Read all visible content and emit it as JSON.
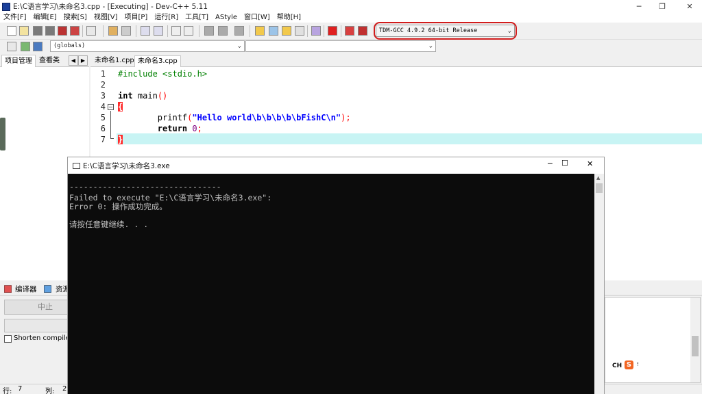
{
  "window": {
    "title": "E:\\C语言学习\\未命名3.cpp - [Executing] - Dev-C++ 5.11",
    "minimize": "─",
    "maximize": "❐",
    "close": "✕"
  },
  "menu": [
    "文件[F]",
    "编辑[E]",
    "搜索[S]",
    "视图[V]",
    "项目[P]",
    "运行[R]",
    "工具[T]",
    "AStyle",
    "窗口[W]",
    "帮助[H]"
  ],
  "toolbar": {
    "compiler": "TDM-GCC 4.9.2 64-bit Release",
    "compiler_highlight_color": "#d21c1c"
  },
  "toolbar2": {
    "scope": "(globals)",
    "member": ""
  },
  "left_tabs": [
    "项目管理",
    "查看类"
  ],
  "editor_tabs": [
    "未命名1.cpp",
    "未命名3.cpp"
  ],
  "code": {
    "line_numbers": [
      "1",
      "2",
      "3",
      "4",
      "5",
      "6",
      "7"
    ],
    "lines": [
      {
        "segments": [
          {
            "t": "#include <stdio.h>",
            "c": "#008000"
          }
        ]
      },
      {
        "segments": []
      },
      {
        "segments": [
          {
            "t": "int",
            "c": "#000000",
            "b": true
          },
          {
            "t": " main",
            "c": "#000000",
            "b": false
          },
          {
            "t": "()",
            "c": "#ff0000",
            "b": false
          }
        ]
      },
      {
        "segments": [
          {
            "t": "{",
            "c": "#ffffff",
            "b": true,
            "box": true
          }
        ]
      },
      {
        "segments": [
          {
            "t": "\t\tprintf",
            "c": "#000000",
            "b": false
          },
          {
            "t": "(",
            "c": "#ff0000",
            "b": false
          },
          {
            "t": "\"Hello world\\b\\b\\b\\b\\bFishC\\n\"",
            "c": "#0000ff",
            "b": true
          },
          {
            "t": ");",
            "c": "#ff0000",
            "b": false
          }
        ]
      },
      {
        "segments": [
          {
            "t": "\t\treturn",
            "c": "#000000",
            "b": true
          },
          {
            "t": " 0",
            "c": "#800080",
            "b": false
          },
          {
            "t": ";",
            "c": "#ff0000",
            "b": false
          }
        ]
      },
      {
        "segments": [
          {
            "t": "}",
            "c": "#ffffff",
            "b": true,
            "box": true
          }
        ]
      }
    ],
    "current_line_color": "#c8f4f4"
  },
  "console": {
    "title": "E:\\C语言学习\\未命名3.exe",
    "lines": [
      "--------------------------------",
      "Failed to execute \"E:\\C语言学习\\未命名3.exe\":",
      "Error 0: 操作成功完成。",
      "",
      "请按任意键继续. . ."
    ]
  },
  "bottom": {
    "tabs": [
      "编译器",
      "资源"
    ],
    "stop_button": "中止",
    "shorten_label": "Shorten compiler p",
    "ime_label": "CH"
  },
  "status": {
    "row_label": "行:",
    "row_value": "7",
    "col_label": "列:",
    "col_value": "2"
  }
}
